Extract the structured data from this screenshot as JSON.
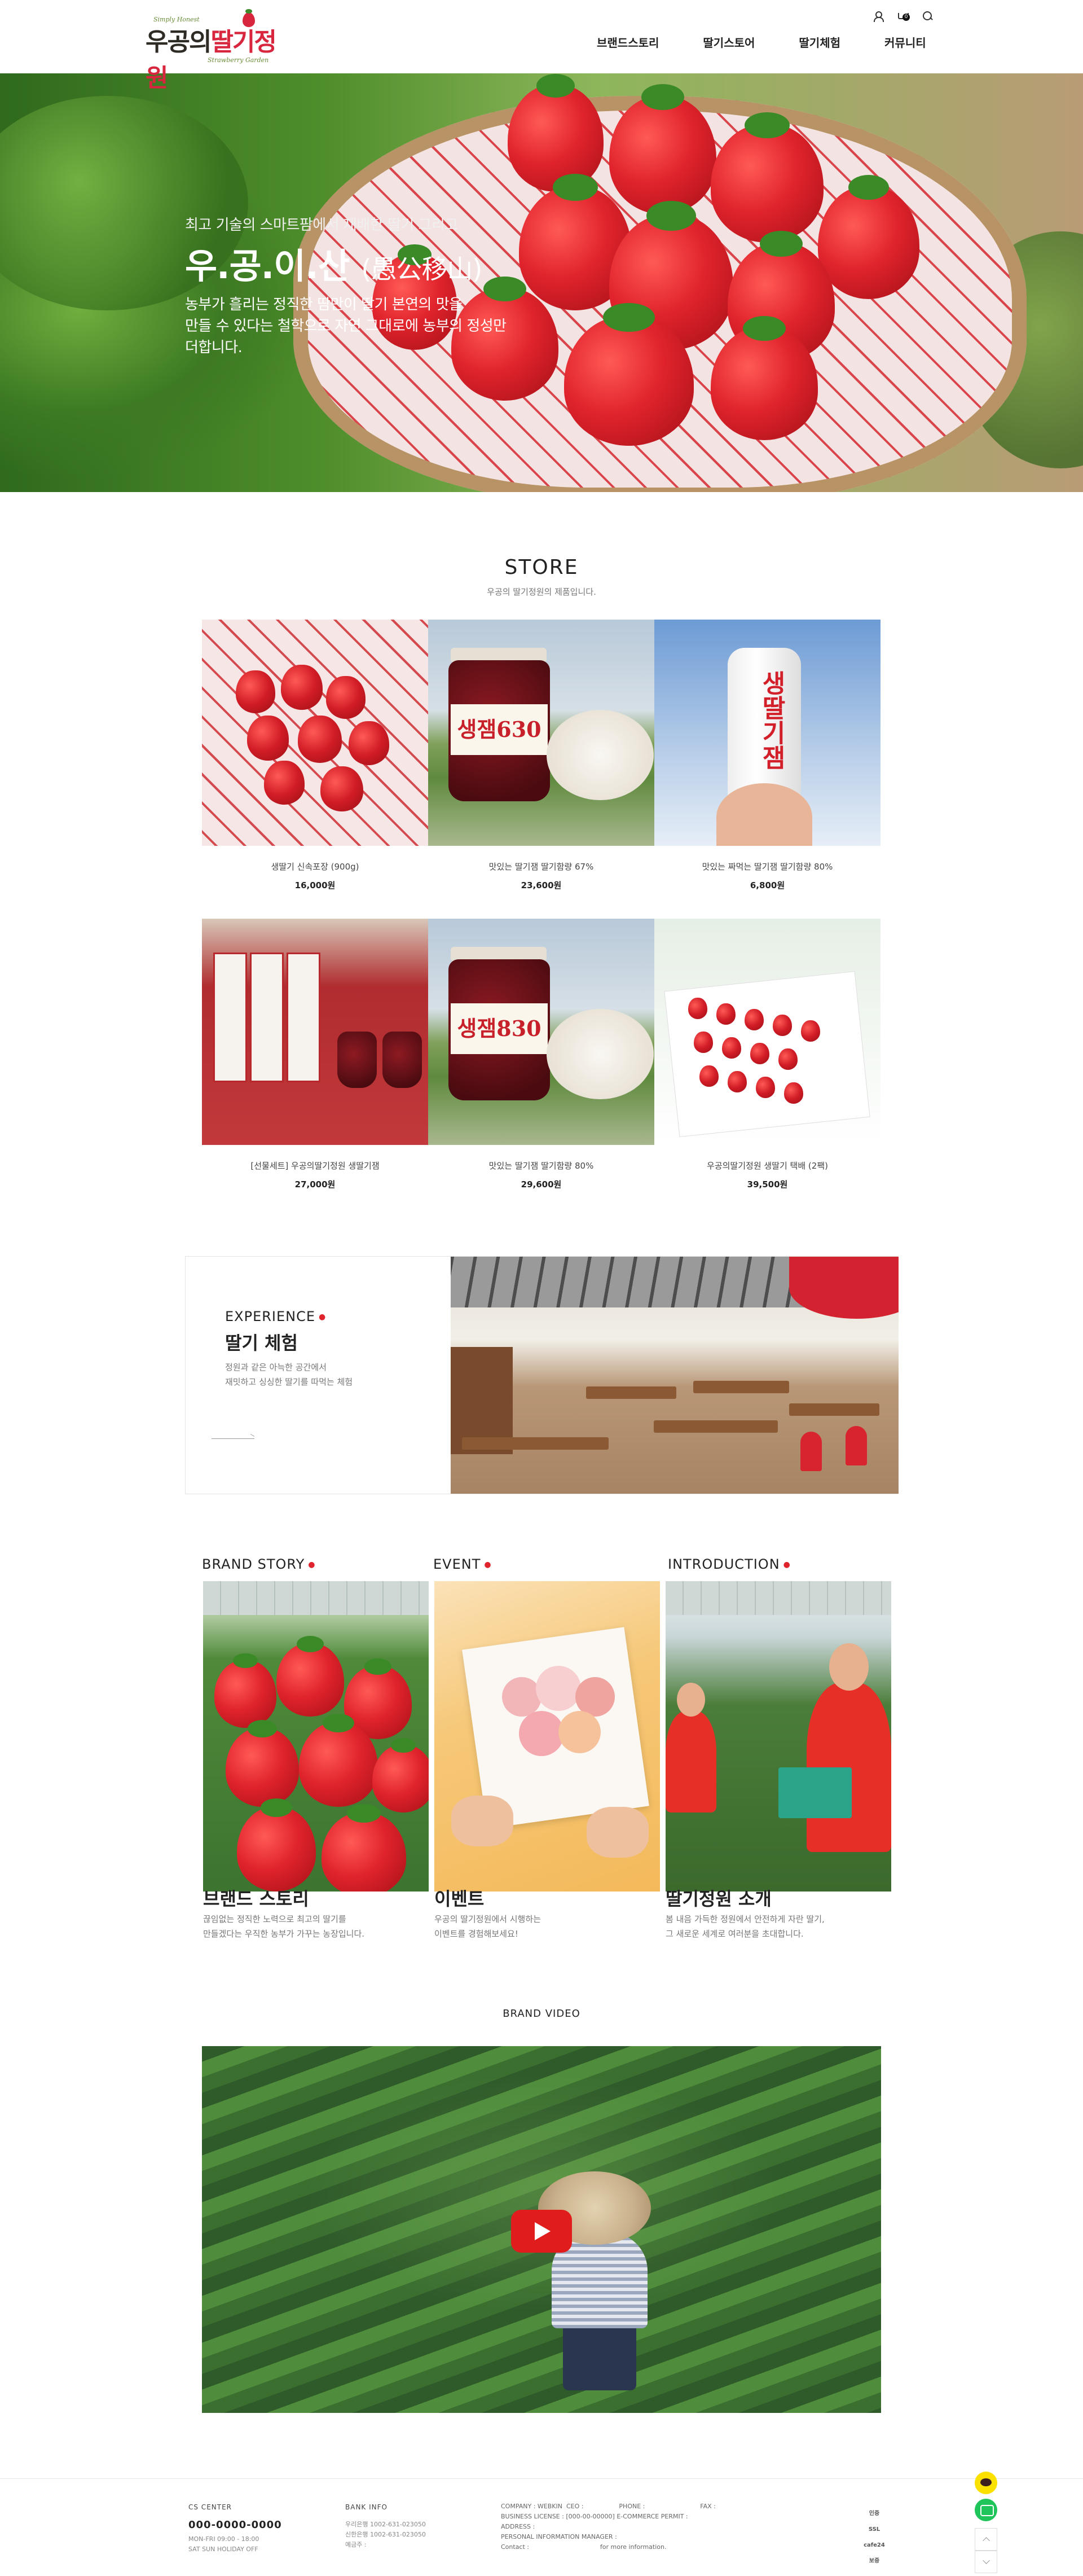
{
  "header": {
    "logo": {
      "tagline": "Simply Honest",
      "name_part1": "우공의",
      "name_part2": "딸기정원",
      "sub": "Strawberry Garden"
    },
    "cart_count": "0",
    "nav": [
      "브랜드스토리",
      "딸기스토어",
      "딸기체험",
      "커뮤니티"
    ]
  },
  "hero": {
    "kicker": "최고 기술의 스마트팜에서 재배한 딸기 그리고",
    "title": "우.공.이.산",
    "title_hanja": "(愚公移山)",
    "desc_line1": "농부가 흘리는 정직한 땀만이 딸기 본연의 맛을",
    "desc_line2": "만들 수 있다는 철학으로 자연 그대로에 농부의 정성만",
    "desc_line3": "더합니다."
  },
  "store": {
    "title": "STORE",
    "subtitle": "우공의 딸기정원의 제품입니다.",
    "products": [
      {
        "name": "생딸기 신속포장 (900g)",
        "price": "16,000원"
      },
      {
        "name": "맛있는 딸기잼 딸기함량 67%",
        "price": "23,600원"
      },
      {
        "name": "맛있는 짜먹는 딸기잼 딸기함량 80%",
        "price": "6,800원"
      },
      {
        "name": "[선물세트] 우공의딸기정원 생딸기잼",
        "price": "27,000원"
      },
      {
        "name": "맛있는 딸기잼 딸기함량 80%",
        "price": "29,600원"
      },
      {
        "name": "우공의딸기정원 생딸기 택배 (2팩)",
        "price": "39,500원"
      }
    ],
    "jam_label_630": "생잼630",
    "jam_label_830": "생잼830",
    "tube_label": "생딸기잼"
  },
  "experience": {
    "eng": "EXPERIENCE",
    "kor": "딸기 체험",
    "desc_line1": "정원과 같은 아늑한 공간에서",
    "desc_line2": "재밋하고 싱싱한 딸기를 따먹는 체험"
  },
  "brand_cards": [
    {
      "eng": "BRAND STORY",
      "title": "브랜드 스토리",
      "desc_line1": "끊임없는 정직한 노력으로 최고의 딸기를",
      "desc_line2": "만들겠다는 우직한 농부가 가꾸는 농장입니다."
    },
    {
      "eng": "EVENT",
      "title": "이벤트",
      "desc_line1": "우공의 딸기정원에서 시행하는",
      "desc_line2": "이벤트를 경험해보세요!"
    },
    {
      "eng": "INTRODUCTION",
      "title": "딸기정원 소개",
      "desc_line1": "봄 내음 가득한 정원에서 안전하게 자란 딸기,",
      "desc_line2": "그 새로운 세계로 여러분을 초대합니다."
    }
  ],
  "video": {
    "title": "BRAND VIDEO"
  },
  "footer": {
    "cs": {
      "title": "CS CENTER",
      "phone": "000-0000-0000",
      "hours": "MON-FRI 09:00 - 18:00",
      "off": "SAT SUN HOLIDAY OFF"
    },
    "bank": {
      "title": "BANK INFO",
      "line1": "우리은행 1002-631-023050",
      "line2": "신한은행 1002-631-023050",
      "line3": "예금주 :"
    },
    "company": {
      "line1": "COMPANY : WEBKIN  CEO :                  PHONE :                            FAX :",
      "line2": "BUSINESS LICENSE : [000-00-00000]  E-COMMERCE PERMIT :",
      "line3": "ADDRESS :",
      "line4": "PERSONAL INFORMATION MANAGER :",
      "line5": "Contact :                                    for more information."
    },
    "certs": [
      "인증",
      "SSL",
      "cafe24",
      "보증"
    ]
  },
  "colors": {
    "accent": "#e0242e",
    "text": "#222222",
    "muted": "#777777"
  }
}
